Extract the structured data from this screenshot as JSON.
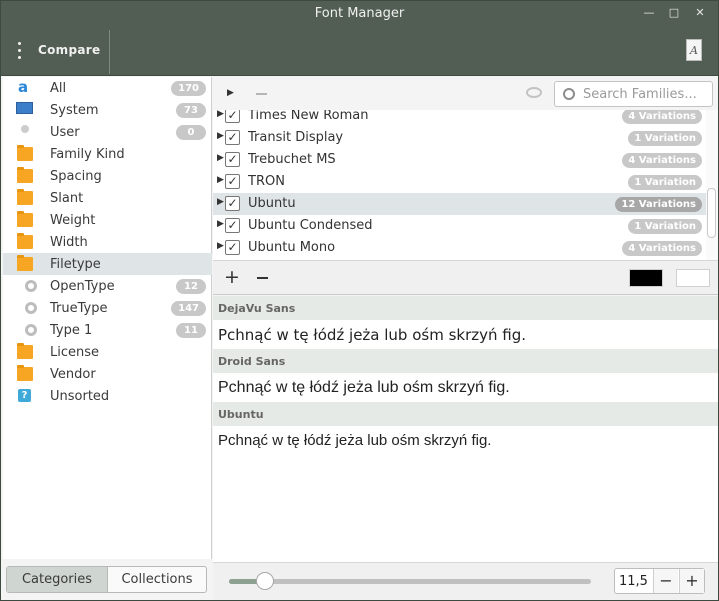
{
  "window": {
    "title": "Font Manager"
  },
  "header": {
    "compare_label": "Compare"
  },
  "sidebar": {
    "items": [
      {
        "label": "All",
        "count": "170",
        "icon": "all-fonts-icon"
      },
      {
        "label": "System",
        "count": "73",
        "icon": "monitor-icon"
      },
      {
        "label": "User",
        "count": "0",
        "icon": "user-icon"
      },
      {
        "label": "Family Kind",
        "icon": "folder-icon"
      },
      {
        "label": "Spacing",
        "icon": "folder-icon"
      },
      {
        "label": "Slant",
        "icon": "folder-icon"
      },
      {
        "label": "Weight",
        "icon": "folder-icon"
      },
      {
        "label": "Width",
        "icon": "folder-icon"
      },
      {
        "label": "Filetype",
        "icon": "folder-open-icon",
        "selected": true
      },
      {
        "label": "OpenType",
        "count": "12",
        "icon": "filetype-icon"
      },
      {
        "label": "TrueType",
        "count": "147",
        "icon": "filetype-icon"
      },
      {
        "label": "Type 1",
        "count": "11",
        "icon": "filetype-icon"
      },
      {
        "label": "License",
        "icon": "folder-icon"
      },
      {
        "label": "Vendor",
        "icon": "folder-icon"
      },
      {
        "label": "Unsorted",
        "icon": "unsorted-icon"
      }
    ],
    "tabs": {
      "categories": "Categories",
      "collections": "Collections"
    }
  },
  "toolbar": {
    "search_placeholder": "Search Families..."
  },
  "families": [
    {
      "name": "Times New Roman",
      "variations": "4  Variations"
    },
    {
      "name": "Transit Display",
      "variations": "1  Variation"
    },
    {
      "name": "Trebuchet MS",
      "variations": "4  Variations"
    },
    {
      "name": "TRON",
      "variations": "1  Variation"
    },
    {
      "name": "Ubuntu",
      "variations": "12  Variations",
      "selected": true
    },
    {
      "name": "Ubuntu Condensed",
      "variations": "1  Variation"
    },
    {
      "name": "Ubuntu Mono",
      "variations": "4  Variations"
    }
  ],
  "compare": {
    "foreground_color": "#000000",
    "background_color": "#ffffff",
    "entries": [
      {
        "font": "DejaVu Sans",
        "sample": "Pchnąć w tę łódź jeża lub ośm skrzyń fig."
      },
      {
        "font": "Droid Sans",
        "sample": "Pchnąć w tę łódź jeża lub ośm skrzyń fig."
      },
      {
        "font": "Ubuntu",
        "sample": "Pchnąć w tę łódź jeża lub ośm skrzyń fig."
      }
    ]
  },
  "size": {
    "value": "11,5",
    "minus": "−",
    "plus": "+",
    "slider_fraction": 0.1
  },
  "colors": {
    "accent": "#525e53",
    "folder": "#f6a623",
    "selection": "#dfe4e6"
  }
}
